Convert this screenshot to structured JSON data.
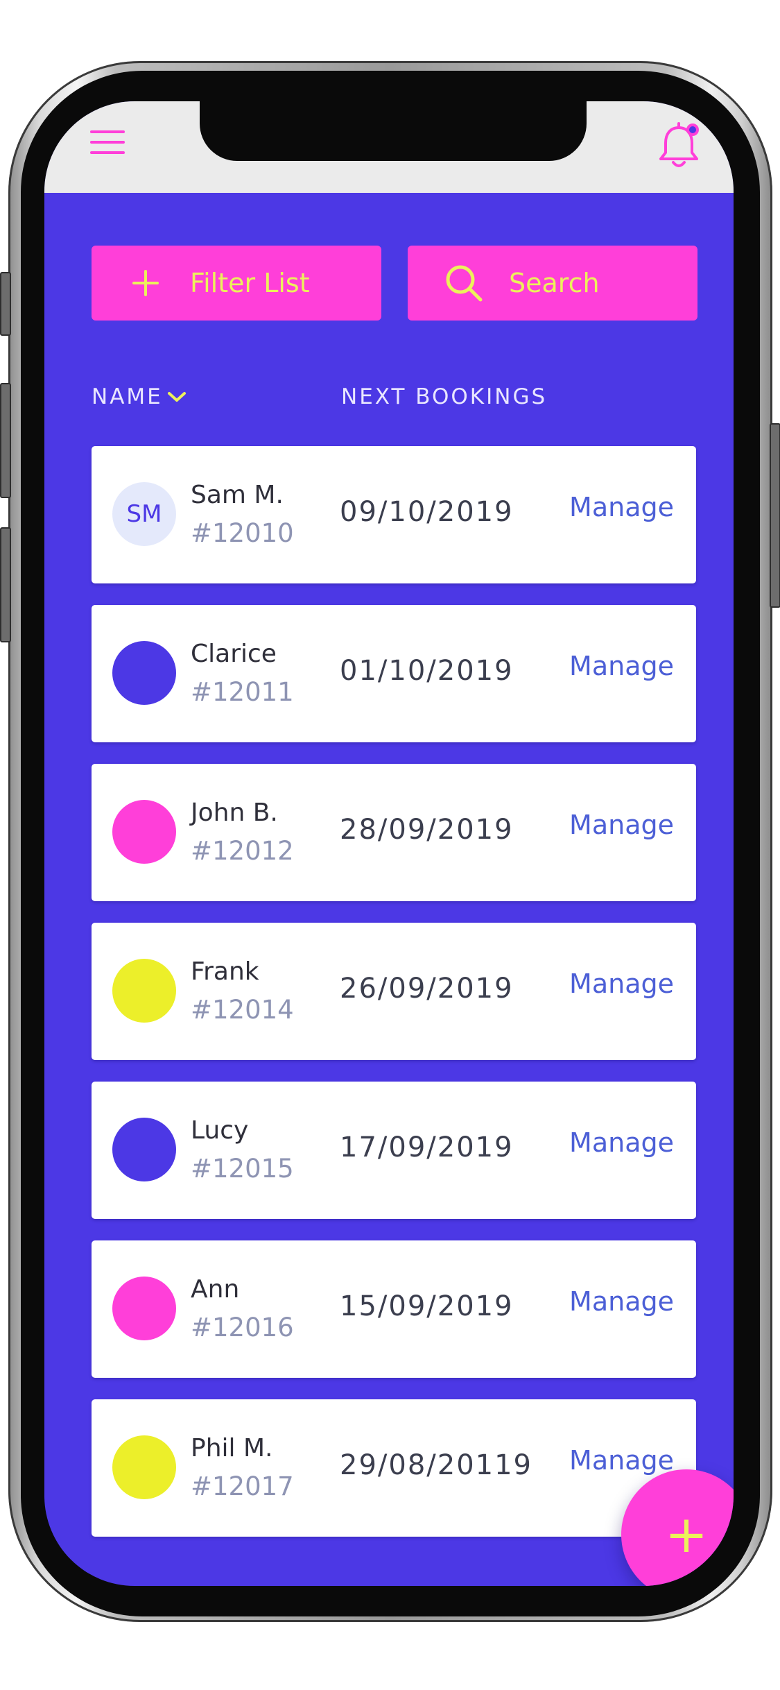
{
  "header": {
    "menu_icon": "hamburger-menu-icon",
    "notification_icon": "bell-icon"
  },
  "toolbar": {
    "filter_label": "Filter List",
    "search_label": "Search"
  },
  "columns": {
    "name": "NAME",
    "next_bookings": "NEXT BOOKINGS"
  },
  "colors": {
    "background": "#4c38e5",
    "accent_pink": "#ff3fd9",
    "accent_yellow": "#ecf15b",
    "link_blue": "#4c5fd6"
  },
  "bookings": [
    {
      "initials": "SM",
      "name": "Sam M.",
      "id": "#12010",
      "date": "09/10/2019",
      "action": "Manage",
      "avatar_color": "#e4e9fb"
    },
    {
      "initials": "",
      "name": "Clarice",
      "id": "#12011",
      "date": "01/10/2019",
      "action": "Manage",
      "avatar_color": "#4c38e5"
    },
    {
      "initials": "",
      "name": "John B.",
      "id": "#12012",
      "date": "28/09/2019",
      "action": "Manage",
      "avatar_color": "#ff3fd9"
    },
    {
      "initials": "",
      "name": "Frank",
      "id": "#12014",
      "date": "26/09/2019",
      "action": "Manage",
      "avatar_color": "#ecef2a"
    },
    {
      "initials": "",
      "name": "Lucy",
      "id": "#12015",
      "date": "17/09/2019",
      "action": "Manage",
      "avatar_color": "#4c38e5"
    },
    {
      "initials": "",
      "name": "Ann",
      "id": "#12016",
      "date": "15/09/2019",
      "action": "Manage",
      "avatar_color": "#ff3fd9"
    },
    {
      "initials": "",
      "name": "Phil M.",
      "id": "#12017",
      "date": "29/08/20119",
      "action": "Manage",
      "avatar_color": "#ecef2a"
    }
  ],
  "fab": {
    "label": "+"
  }
}
